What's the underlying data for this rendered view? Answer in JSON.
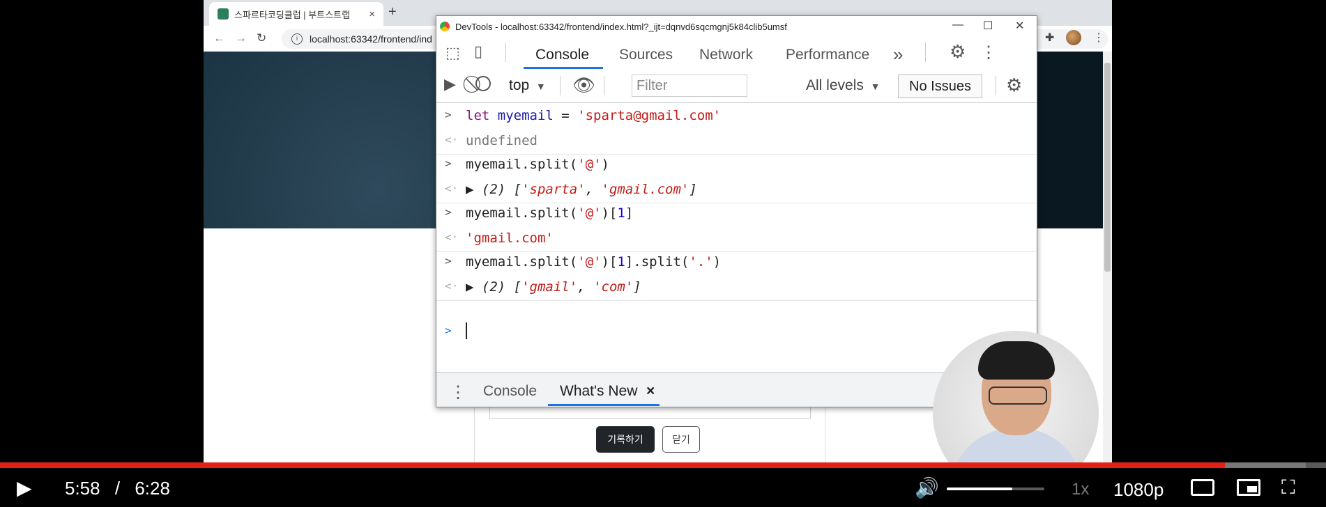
{
  "browser": {
    "tab_title": "스파르타코딩클럽 | 부트스트랩",
    "tab_close": "×",
    "new_tab": "+",
    "url": "localhost:63342/frontend/ind"
  },
  "page": {
    "save_button": "기록하기",
    "close_button": "닫기"
  },
  "devtools": {
    "title": "DevTools - localhost:63342/frontend/index.html?_ijt=dqnvd6sqcmgnj5k84clib5umsf",
    "tabs": [
      "Console",
      "Sources",
      "Network",
      "Performance"
    ],
    "more_tabs": "»",
    "context": "top",
    "filter_placeholder": "Filter",
    "levels": "All levels",
    "issues": "No Issues",
    "console_lines": [
      {
        "type": "input",
        "tokens": [
          [
            "kw",
            "let "
          ],
          [
            "var",
            "myemail"
          ],
          [
            "plain",
            " = "
          ],
          [
            "str",
            "'sparta@gmail.com'"
          ]
        ]
      },
      {
        "type": "output",
        "tokens": [
          [
            "gray",
            "undefined"
          ]
        ]
      },
      {
        "type": "input",
        "tokens": [
          [
            "plain",
            "myemail.split("
          ],
          [
            "str",
            "'@'"
          ],
          [
            "plain",
            ")"
          ]
        ]
      },
      {
        "type": "output",
        "tokens": [
          [
            "plain",
            "▶ "
          ],
          [
            "plain it",
            "(2) ["
          ],
          [
            "str it",
            "'sparta'"
          ],
          [
            "plain it",
            ", "
          ],
          [
            "str it",
            "'gmail.com'"
          ],
          [
            "plain it",
            "]"
          ]
        ]
      },
      {
        "type": "input",
        "tokens": [
          [
            "plain",
            "myemail.split("
          ],
          [
            "str",
            "'@'"
          ],
          [
            "plain",
            ")["
          ],
          [
            "num",
            "1"
          ],
          [
            "plain",
            "]"
          ]
        ]
      },
      {
        "type": "output",
        "tokens": [
          [
            "str",
            "'gmail.com'"
          ]
        ]
      },
      {
        "type": "input",
        "tokens": [
          [
            "plain",
            "myemail.split("
          ],
          [
            "str",
            "'@'"
          ],
          [
            "plain",
            ")["
          ],
          [
            "num",
            "1"
          ],
          [
            "plain",
            "].split("
          ],
          [
            "str",
            "'.'"
          ],
          [
            "plain",
            ")"
          ]
        ]
      },
      {
        "type": "output",
        "tokens": [
          [
            "plain",
            "▶ "
          ],
          [
            "plain it",
            "(2) ["
          ],
          [
            "str it",
            "'gmail'"
          ],
          [
            "plain it",
            ", "
          ],
          [
            "str it",
            "'com'"
          ],
          [
            "plain it",
            "]"
          ]
        ]
      }
    ],
    "drawer_tabs": [
      "Console",
      "What's New"
    ],
    "drawer_close": "×"
  },
  "video": {
    "current_time": "5:58",
    "separator": "/",
    "duration": "6:28",
    "progress_fraction": 0.924,
    "volume_fraction": 0.67,
    "speed": "1x",
    "quality": "1080p"
  },
  "colors": {
    "progress": "#e52117",
    "devtools_accent": "#1a73e8"
  }
}
